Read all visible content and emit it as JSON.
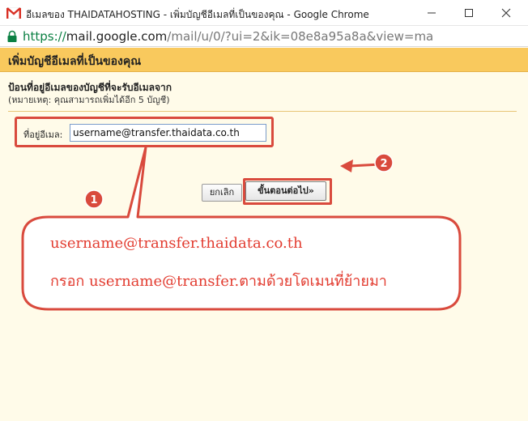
{
  "window": {
    "title": "อีเมลของ THAIDATAHOSTING - เพิ่มบัญชีอีเมลที่เป็นของคุณ - Google Chrome",
    "minimize_symbol": "—",
    "maximize_symbol": "☐",
    "close_symbol": "✕"
  },
  "address": {
    "scheme": "https://",
    "host": "mail.google.com",
    "path": "/mail/u/0/?ui=2&ik=08e8a95a8a&view=ma"
  },
  "dialog": {
    "title": "เพิ่มบัญชีอีเมลที่เป็นของคุณ",
    "instruction": "ป้อนที่อยู่อีเมลของบัญชีที่จะรับอีเมลจาก",
    "note": "(หมายเหตุ: คุณสามารถเพิ่มได้อีก 5 บัญชี)",
    "email_label": "ที่อยู่อีเมล:",
    "email_value": "username@transfer.thaidata.co.th",
    "cancel_label": "ยกเลิก",
    "next_label": "ขั้นตอนต่อไป»"
  },
  "annotations": {
    "badge_1": "1",
    "badge_2": "2",
    "callout_line1": "username@transfer.thaidata.co.th",
    "callout_line2": "กรอก username@transfer.ตามด้วยโดเมนที่ย้ายมา",
    "annotation_color": "#d94a3d"
  },
  "colors": {
    "header_bar": "#f9c95d",
    "panel_bg": "#fffbe9",
    "url_scheme": "#0b8043"
  }
}
